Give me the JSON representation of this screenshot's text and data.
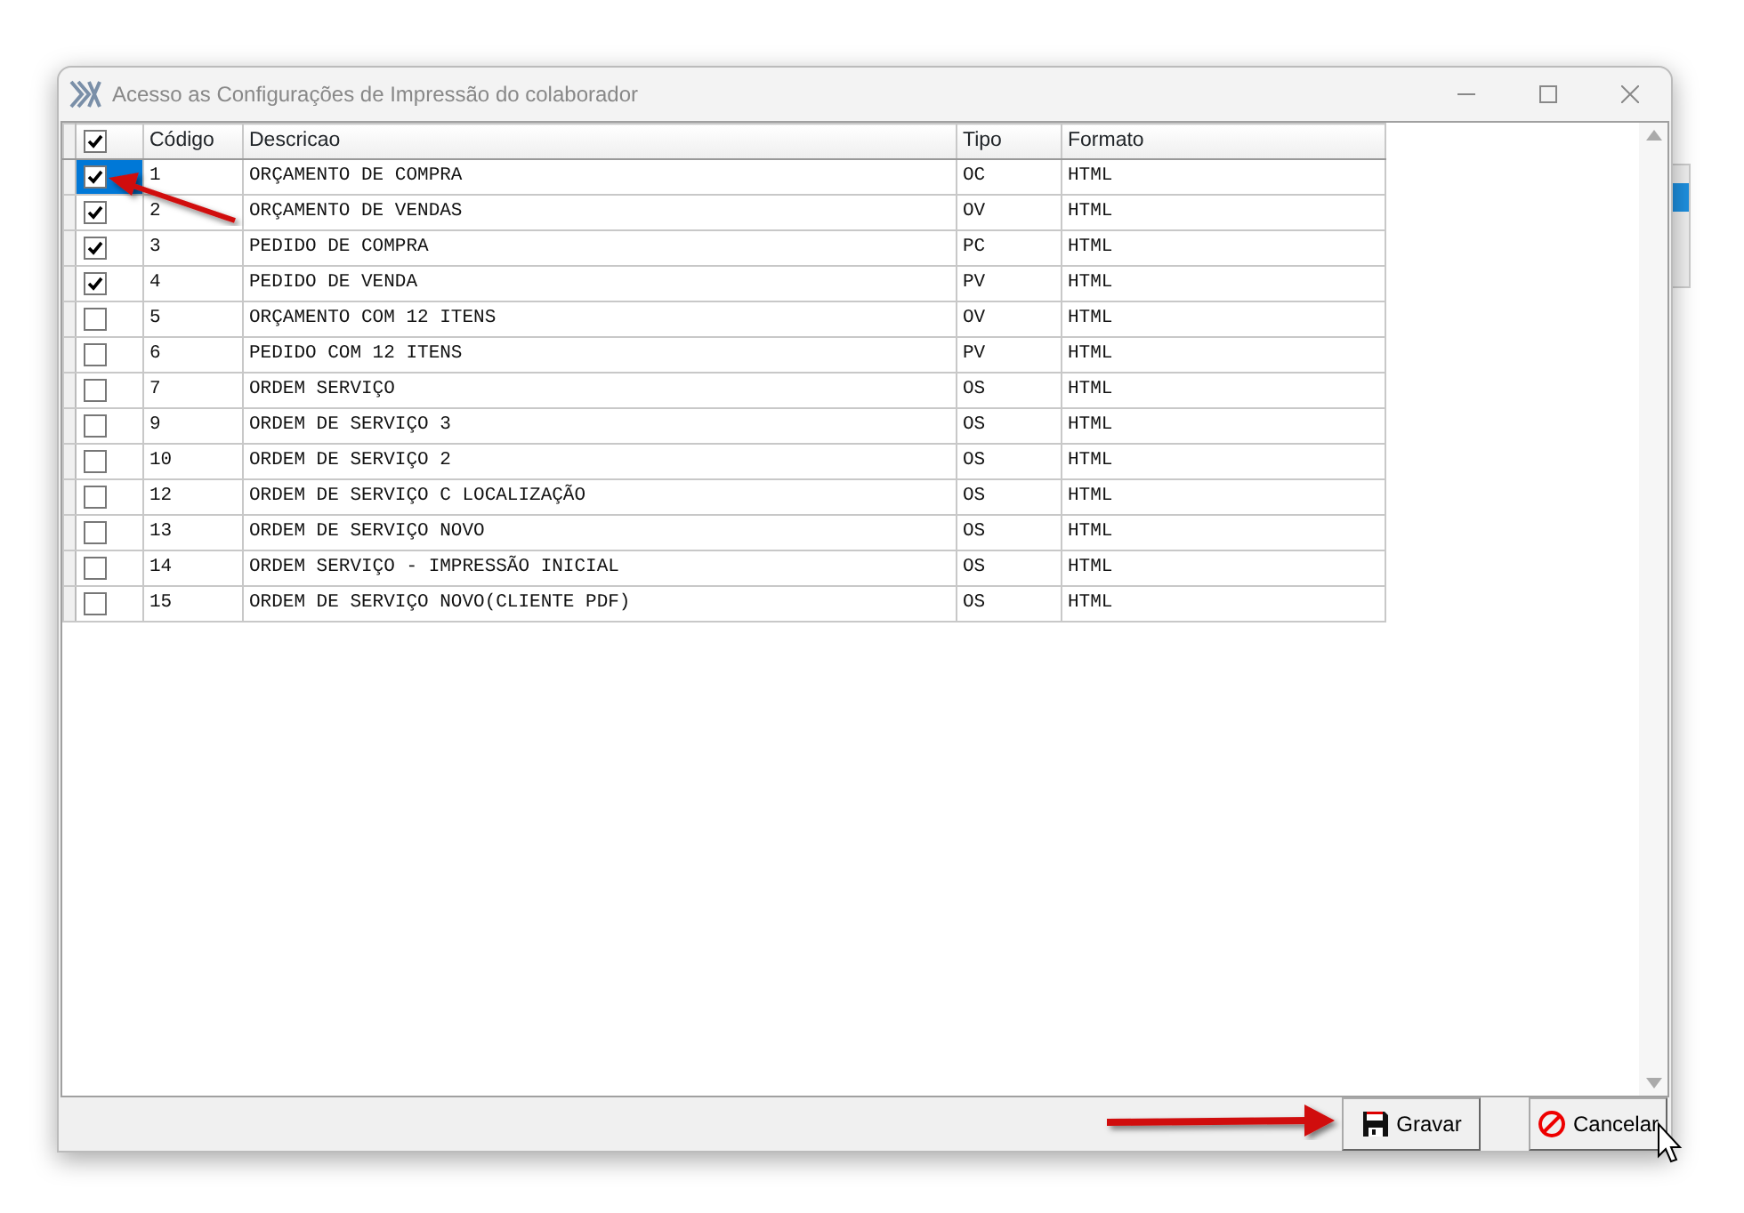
{
  "window": {
    "title": "Acesso as Configurações de Impressão do colaborador"
  },
  "table": {
    "header_checked": true,
    "columns": [
      "Código",
      "Descricao",
      "Tipo",
      "Formato"
    ],
    "rows": [
      {
        "checked": true,
        "selected": true,
        "cells": [
          "1",
          "ORÇAMENTO DE COMPRA",
          "OC",
          "HTML"
        ]
      },
      {
        "checked": true,
        "selected": false,
        "cells": [
          "2",
          "ORÇAMENTO DE VENDAS",
          "OV",
          "HTML"
        ]
      },
      {
        "checked": true,
        "selected": false,
        "cells": [
          "3",
          "PEDIDO DE COMPRA",
          "PC",
          "HTML"
        ]
      },
      {
        "checked": true,
        "selected": false,
        "cells": [
          "4",
          "PEDIDO DE VENDA",
          "PV",
          "HTML"
        ]
      },
      {
        "checked": false,
        "selected": false,
        "cells": [
          "5",
          "ORÇAMENTO COM 12 ITENS",
          "OV",
          "HTML"
        ]
      },
      {
        "checked": false,
        "selected": false,
        "cells": [
          "6",
          "PEDIDO COM 12 ITENS",
          "PV",
          "HTML"
        ]
      },
      {
        "checked": false,
        "selected": false,
        "cells": [
          "7",
          "ORDEM SERVIÇO",
          "OS",
          "HTML"
        ]
      },
      {
        "checked": false,
        "selected": false,
        "cells": [
          "9",
          "ORDEM DE SERVIÇO 3",
          "OS",
          "HTML"
        ]
      },
      {
        "checked": false,
        "selected": false,
        "cells": [
          "10",
          "ORDEM DE SERVIÇO 2",
          "OS",
          "HTML"
        ]
      },
      {
        "checked": false,
        "selected": false,
        "cells": [
          "12",
          "ORDEM DE SERVIÇO C LOCALIZAÇÃO",
          "OS",
          "HTML"
        ]
      },
      {
        "checked": false,
        "selected": false,
        "cells": [
          "13",
          "ORDEM DE SERVIÇO NOVO",
          "OS",
          "HTML"
        ]
      },
      {
        "checked": false,
        "selected": false,
        "cells": [
          "14",
          "ORDEM SERVIÇO - IMPRESSÃO INICIAL",
          "OS",
          "HTML"
        ]
      },
      {
        "checked": false,
        "selected": false,
        "cells": [
          "15",
          "ORDEM DE SERVIÇO NOVO(CLIENTE PDF)",
          "OS",
          "HTML"
        ]
      }
    ]
  },
  "buttons": [
    {
      "kind": "save",
      "label": "Gravar"
    },
    {
      "kind": "cancel",
      "label": "Cancelar"
    }
  ]
}
